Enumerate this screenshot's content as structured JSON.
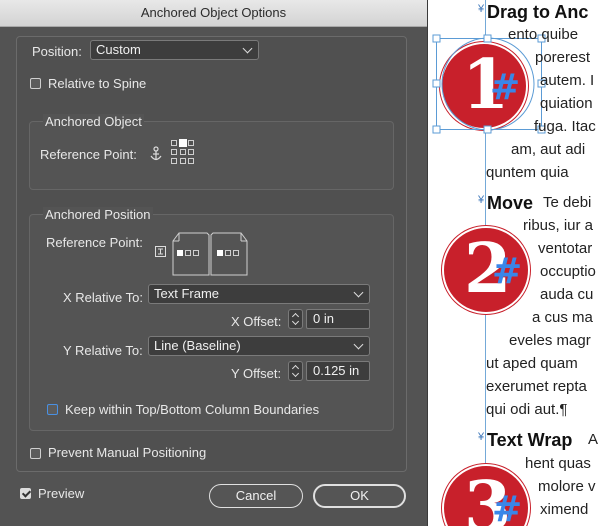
{
  "dialog": {
    "title": "Anchored Object Options",
    "position_label": "Position:",
    "position_value": "Custom",
    "relative_to_spine": "Relative to Spine",
    "anchored_object": {
      "title": "Anchored Object",
      "reference_point_label": "Reference Point:"
    },
    "anchored_position": {
      "title": "Anchored Position",
      "reference_point_label": "Reference Point:",
      "x_relative_label": "X Relative To:",
      "x_relative_value": "Text Frame",
      "x_offset_label": "X Offset:",
      "x_offset_value": "0 in",
      "y_relative_label": "Y Relative To:",
      "y_relative_value": "Line (Baseline)",
      "y_offset_label": "Y Offset:",
      "y_offset_value": "0.125 in",
      "keep_within": "Keep within Top/Bottom Column Boundaries"
    },
    "prevent_manual": "Prevent Manual Positioning",
    "preview_label": "Preview",
    "cancel_label": "Cancel",
    "ok_label": "OK"
  },
  "document": {
    "sections": [
      {
        "heading": "Drag to Anc",
        "number": "1",
        "lines": [
          "ento quibe",
          "porerest",
          "autem. I",
          "quiation",
          "fuga. Itac",
          "am, aut adi",
          "quntem quia"
        ]
      },
      {
        "heading": "Move",
        "heading_tail": "Te debi",
        "number": "2",
        "lines": [
          "ribus, iur a",
          "ventotar",
          "occuptio",
          "auda cu",
          "a cus ma",
          "eveles magr",
          "ut aped quam",
          "exerumet repta",
          "qui odi aut.¶"
        ]
      },
      {
        "heading": "Text Wrap",
        "heading_tail": "A",
        "number": "3",
        "lines": [
          "hent quas",
          "molore v",
          "ximend"
        ]
      }
    ],
    "hash_symbol": "#",
    "anchor_symbol": "¥"
  }
}
